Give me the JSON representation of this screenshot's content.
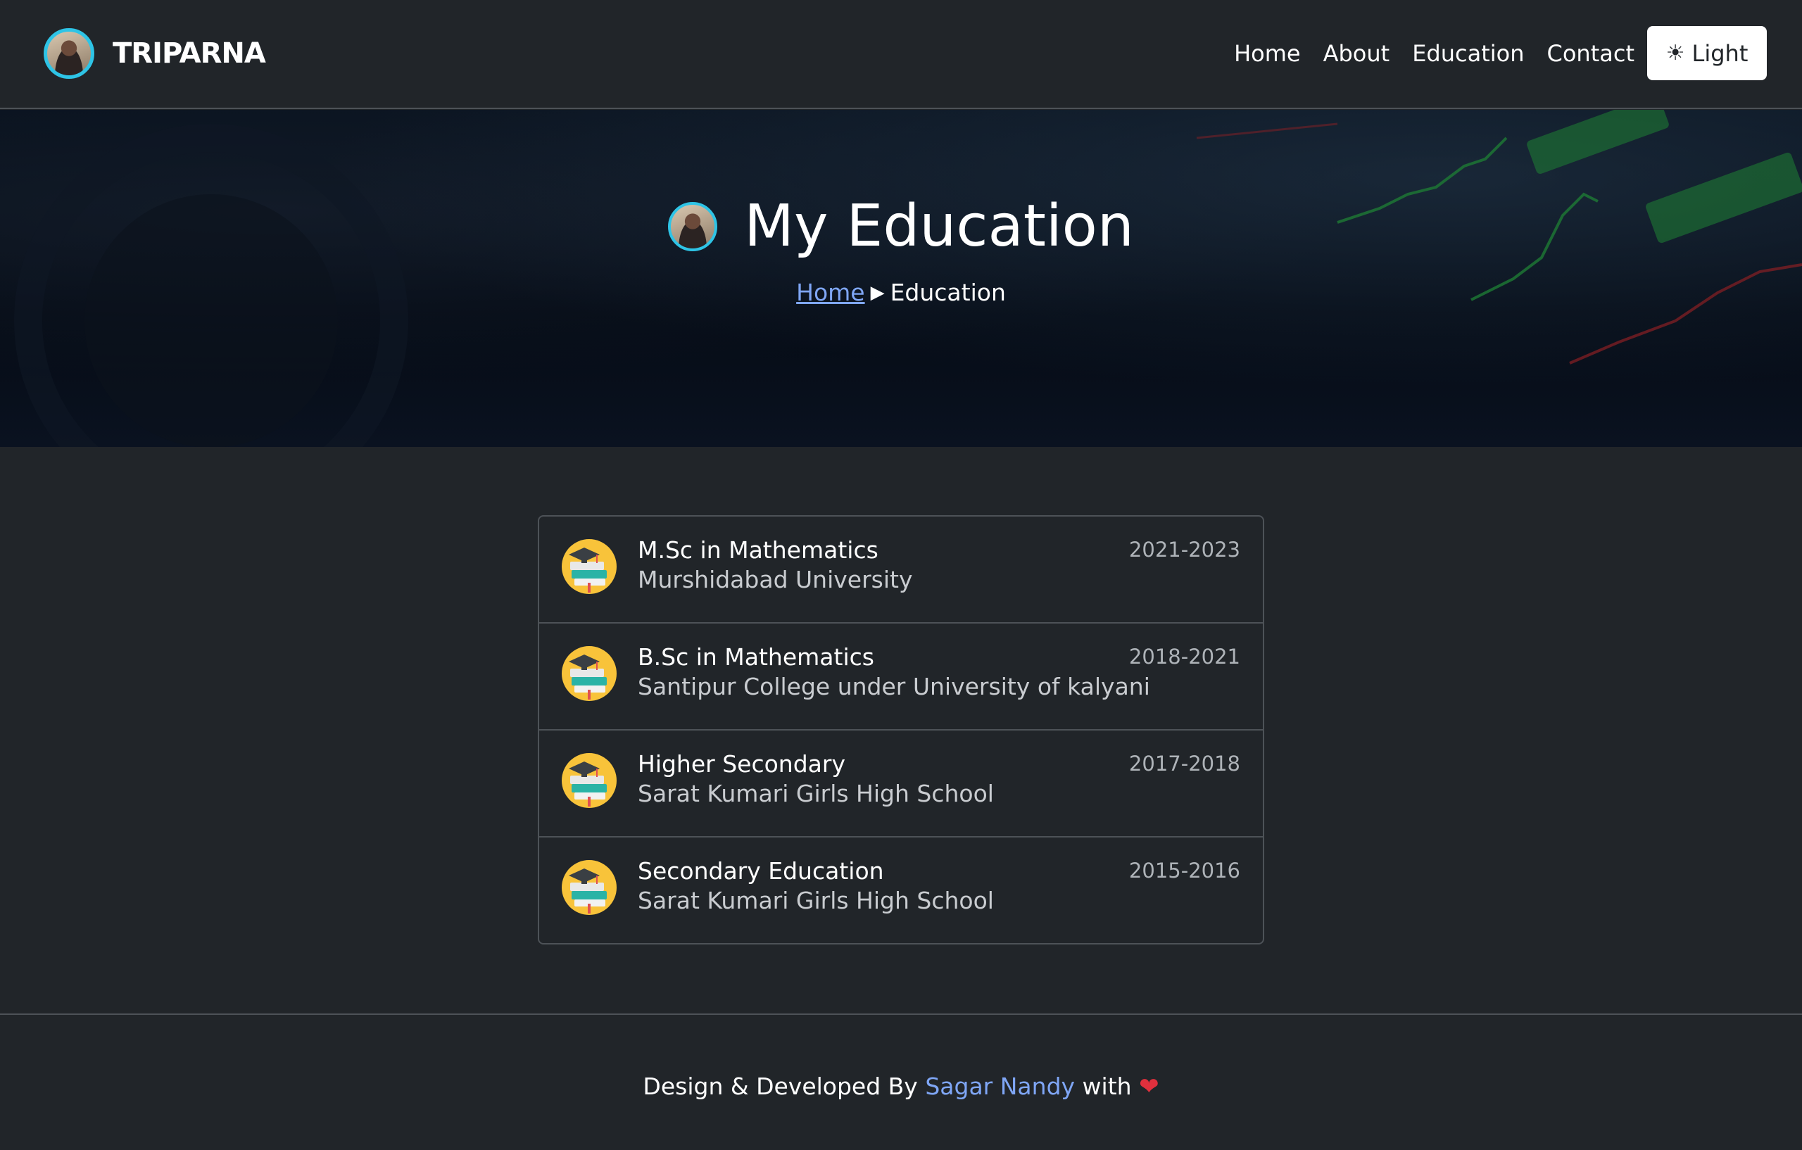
{
  "brand": {
    "name": "TRIPARNA"
  },
  "nav": {
    "items": [
      {
        "label": "Home"
      },
      {
        "label": "About"
      },
      {
        "label": "Education"
      },
      {
        "label": "Contact"
      }
    ],
    "theme_toggle": {
      "icon": "sun-icon",
      "label": "Light"
    }
  },
  "hero": {
    "title": "My Education",
    "breadcrumb": {
      "home": "Home",
      "current": "Education"
    }
  },
  "education": [
    {
      "degree": "M.Sc in Mathematics",
      "school": "Murshidabad University",
      "years": "2021-2023"
    },
    {
      "degree": "B.Sc in Mathematics",
      "school": "Santipur College under University of kalyani",
      "years": "2018-2021"
    },
    {
      "degree": "Higher Secondary",
      "school": "Sarat Kumari Girls High School",
      "years": "2017-2018"
    },
    {
      "degree": "Secondary Education",
      "school": "Sarat Kumari Girls High School",
      "years": "2015-2016"
    }
  ],
  "footer": {
    "prefix": "Design & Developed By",
    "author": "Sagar Nandy",
    "suffix": "with"
  },
  "colors": {
    "background": "#212529",
    "accent_link": "#7fa6f5",
    "avatar_ring": "#2ec4e6",
    "icon_bg": "#f8c33a",
    "heart": "#e0303d"
  }
}
